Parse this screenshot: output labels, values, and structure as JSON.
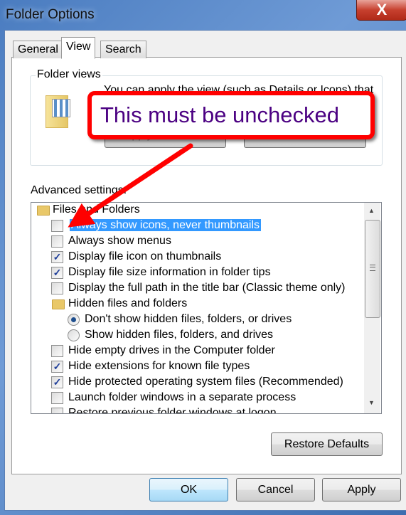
{
  "window": {
    "title": "Folder Options",
    "close_label": "X"
  },
  "tabs": [
    {
      "label": "General"
    },
    {
      "label": "View",
      "active": true
    },
    {
      "label": "Search"
    }
  ],
  "folder_views": {
    "legend": "Folder views",
    "description": "You can apply the view (such as Details or Icons) that",
    "apply_label": "Apply to Folders",
    "reset_label": "Reset Folders"
  },
  "advanced": {
    "label": "Advanced settings:",
    "items": [
      {
        "type": "folder",
        "label": "Files and Folders"
      },
      {
        "type": "checkbox",
        "label": "Always show icons, never thumbnails",
        "checked": false,
        "selected": true
      },
      {
        "type": "checkbox",
        "label": "Always show menus",
        "checked": false
      },
      {
        "type": "checkbox",
        "label": "Display file icon on thumbnails",
        "checked": true
      },
      {
        "type": "checkbox",
        "label": "Display file size information in folder tips",
        "checked": true
      },
      {
        "type": "checkbox",
        "label": "Display the full path in the title bar (Classic theme only)",
        "checked": false
      },
      {
        "type": "folder",
        "label": "Hidden files and folders",
        "indent": 1
      },
      {
        "type": "radio",
        "label": "Don't show hidden files, folders, or drives",
        "checked": true
      },
      {
        "type": "radio",
        "label": "Show hidden files, folders, and drives",
        "checked": false
      },
      {
        "type": "checkbox",
        "label": "Hide empty drives in the Computer folder",
        "checked": false
      },
      {
        "type": "checkbox",
        "label": "Hide extensions for known file types",
        "checked": true
      },
      {
        "type": "checkbox",
        "label": "Hide protected operating system files (Recommended)",
        "checked": true
      },
      {
        "type": "checkbox",
        "label": "Launch folder windows in a separate process",
        "checked": false
      },
      {
        "type": "checkbox",
        "label": "Restore previous folder windows at logon",
        "checked": false
      }
    ]
  },
  "restore_defaults_label": "Restore Defaults",
  "buttons": {
    "ok": "OK",
    "cancel": "Cancel",
    "apply": "Apply"
  },
  "annotation": {
    "text": "This must be unchecked",
    "text_color": "#4b0082",
    "border_color": "#ff0000"
  }
}
